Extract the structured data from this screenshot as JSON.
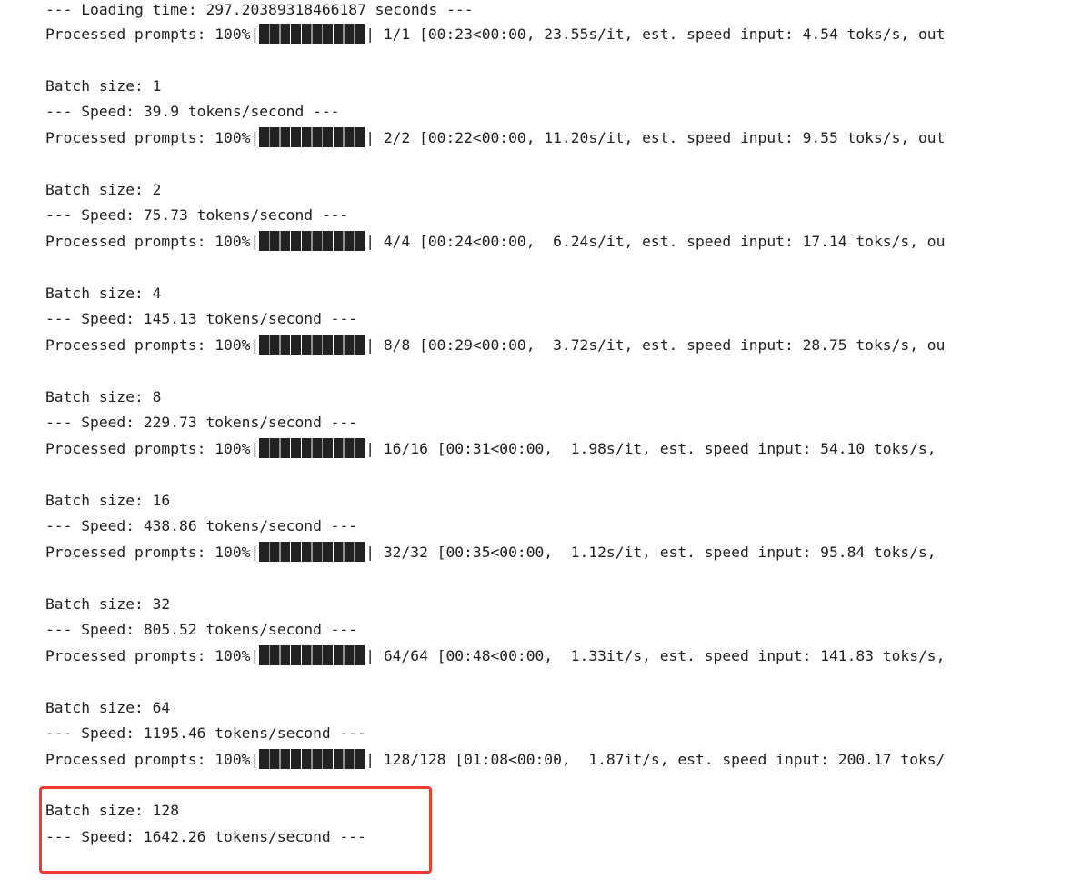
{
  "lines": {
    "loading": "--- Loading time: 297.20389318466187 seconds ---",
    "p1_pre": "Processed prompts: 100%|",
    "p1_post": "| 1/1 [00:23<00:00, 23.55s/it, est. speed input: 4.54 toks/s, out",
    "b1": "Batch size: 1",
    "s1": "--- Speed: 39.9 tokens/second ---",
    "p2_pre": "Processed prompts: 100%|",
    "p2_post": "| 2/2 [00:22<00:00, 11.20s/it, est. speed input: 9.55 toks/s, out",
    "b2": "Batch size: 2",
    "s2": "--- Speed: 75.73 tokens/second ---",
    "p3_pre": "Processed prompts: 100%|",
    "p3_post": "| 4/4 [00:24<00:00,  6.24s/it, est. speed input: 17.14 toks/s, ou",
    "b3": "Batch size: 4",
    "s3": "--- Speed: 145.13 tokens/second ---",
    "p4_pre": "Processed prompts: 100%|",
    "p4_post": "| 8/8 [00:29<00:00,  3.72s/it, est. speed input: 28.75 toks/s, ou",
    "b4": "Batch size: 8",
    "s4": "--- Speed: 229.73 tokens/second ---",
    "p5_pre": "Processed prompts: 100%|",
    "p5_post": "| 16/16 [00:31<00:00,  1.98s/it, est. speed input: 54.10 toks/s,",
    "b5": "Batch size: 16",
    "s5": "--- Speed: 438.86 tokens/second ---",
    "p6_pre": "Processed prompts: 100%|",
    "p6_post": "| 32/32 [00:35<00:00,  1.12s/it, est. speed input: 95.84 toks/s,",
    "b6": "Batch size: 32",
    "s6": "--- Speed: 805.52 tokens/second ---",
    "p7_pre": "Processed prompts: 100%|",
    "p7_post": "| 64/64 [00:48<00:00,  1.33it/s, est. speed input: 141.83 toks/s,",
    "b7": "Batch size: 64",
    "s7": "--- Speed: 1195.46 tokens/second ---",
    "p8_pre": "Processed prompts: 100%|",
    "p8_post": "| 128/128 [01:08<00:00,  1.87it/s, est. speed input: 200.17 toks/",
    "b8": "Batch size: 128",
    "s8": "--- Speed: 1642.26 tokens/second ---"
  },
  "progress": 1.0,
  "colors": {
    "text": "#212121",
    "bar": "#222222",
    "highlight": "#ef3a2f",
    "background": "#ffffff"
  }
}
